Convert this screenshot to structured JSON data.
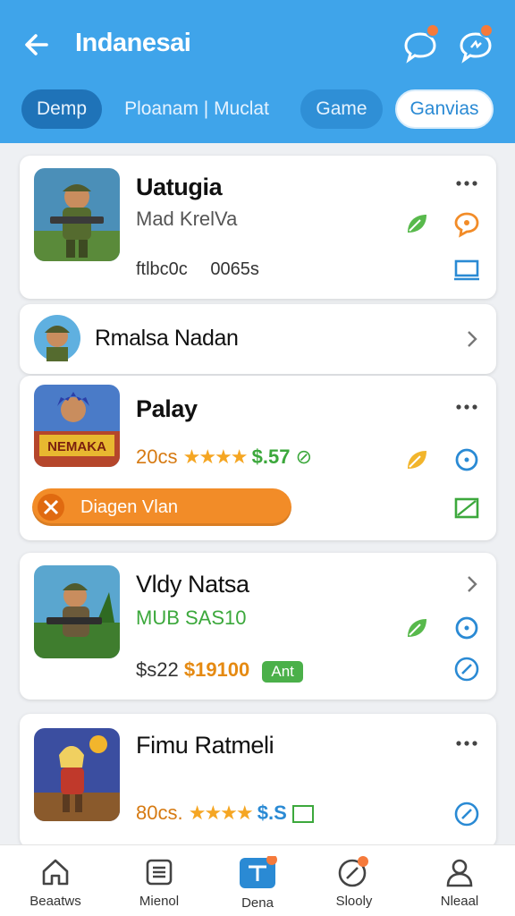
{
  "header": {
    "title": "Indanesai"
  },
  "tabs": [
    {
      "label": "Demp"
    },
    {
      "label": "Ploanam | Muclat"
    },
    {
      "label": "Game"
    },
    {
      "label": "Ganvias"
    }
  ],
  "cards": [
    {
      "name": "Uatugia",
      "subtitle": "Mad KrelVa",
      "meta_left": "ftlbc0c",
      "meta_right": "0065s"
    },
    {
      "name": "Rmalsa Nadan"
    },
    {
      "name": "Palay",
      "price_left": "20cs",
      "price_right": "$.57",
      "promo": "Diagen Vlan",
      "thumb_text": "NEMAKA"
    },
    {
      "name": "Vldy Natsa",
      "subtitle": "MUB SAS10",
      "price_a": "$s22",
      "price_b": "$19100",
      "tag": "Ant"
    },
    {
      "name": "Fimu Ratmeli",
      "price_left": "80cs.",
      "price_right": "$.S"
    }
  ],
  "bottom_nav": [
    {
      "label": "Beaatws"
    },
    {
      "label": "Mienol"
    },
    {
      "label": "Dena"
    },
    {
      "label": "Slooly"
    },
    {
      "label": "Nleaal"
    }
  ],
  "colors": {
    "header_bg": "#3fa4ea",
    "accent_blue": "#2a8ad4",
    "accent_green": "#3ca83c",
    "accent_orange": "#f28c28",
    "star": "#f5a623"
  }
}
